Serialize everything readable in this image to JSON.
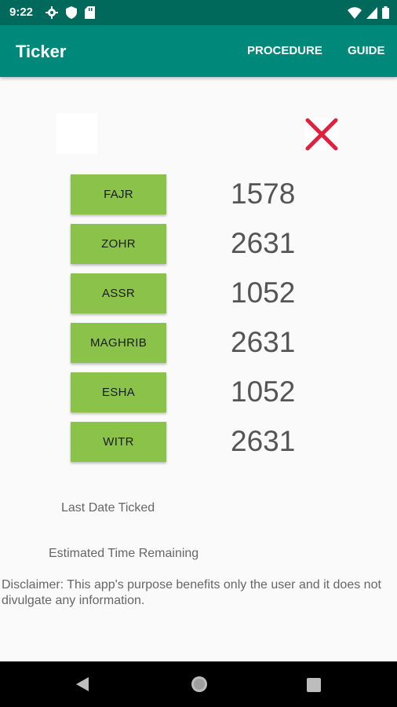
{
  "status_bar": {
    "time": "9:22",
    "left_icons": [
      "gear-icon",
      "shield-icon",
      "sd-card-icon"
    ],
    "right_icons": [
      "wifi-icon",
      "signal-icon",
      "battery-icon"
    ]
  },
  "app_bar": {
    "title": "Ticker",
    "actions": [
      "PROCEDURE",
      "GUIDE"
    ],
    "color": "#00897b",
    "status_color": "#00695c"
  },
  "prayers": [
    {
      "label": "FAJR",
      "count": "1578"
    },
    {
      "label": "ZOHR",
      "count": "2631"
    },
    {
      "label": "ASSR",
      "count": "1052"
    },
    {
      "label": "MAGHRIB",
      "count": "2631"
    },
    {
      "label": "ESHA",
      "count": "1052"
    },
    {
      "label": "WITR",
      "count": "2631"
    }
  ],
  "button_color": "#8bc34a",
  "cross_icon_color": "#e0203c",
  "labels": {
    "last_date": "Last Date Ticked",
    "estimated": "Estimated Time Remaining",
    "disclaimer": "Disclaimer: This app's purpose benefits only the user and it does not divulgate any information."
  },
  "nav_bar": {
    "icons": [
      "back-icon",
      "home-icon",
      "recents-icon"
    ]
  }
}
